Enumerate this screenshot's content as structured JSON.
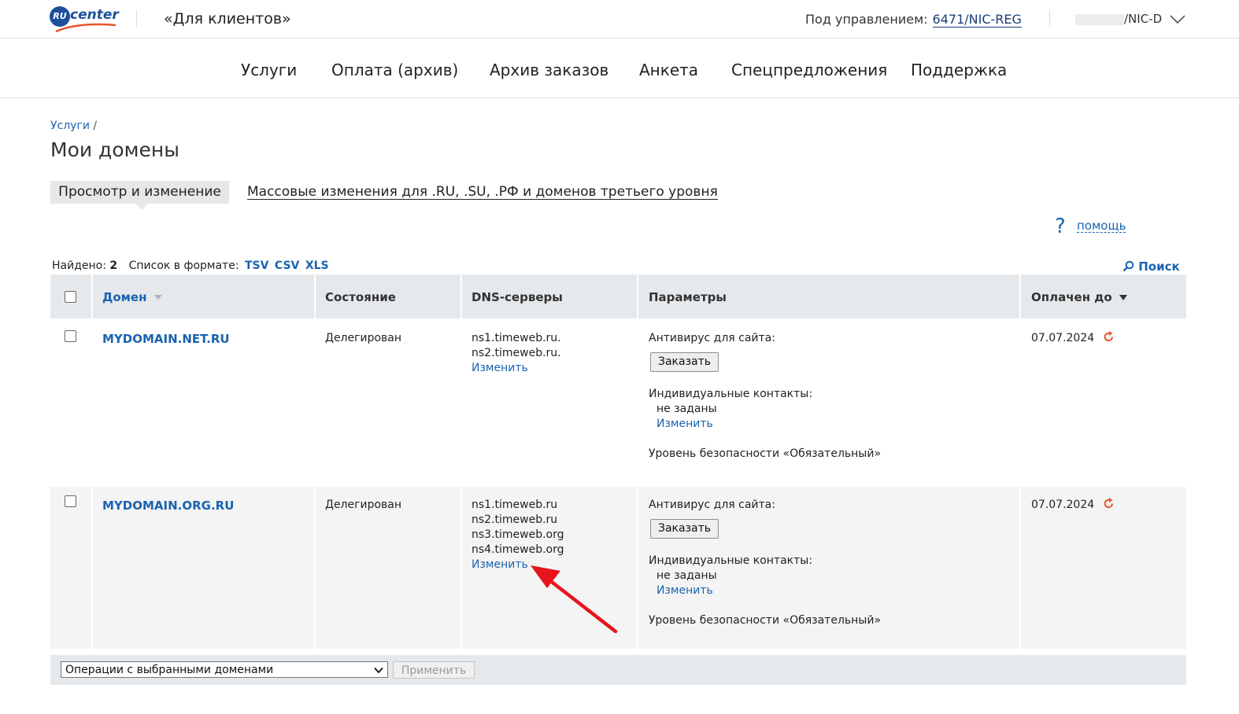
{
  "topbar": {
    "logo_ru": "RU",
    "logo_center": "center",
    "client_title": "«Для клиентов»",
    "managed_label": "Под управлением:",
    "managed_account": "6471/NIC-REG",
    "account_suffix": "/NIC-D"
  },
  "nav": {
    "items": [
      "Услуги",
      "Оплата (архив)",
      "Архив заказов",
      "Анкета",
      "Спецпредложения",
      "Поддержка"
    ]
  },
  "breadcrumb": {
    "link": "Услуги",
    "sep": "/"
  },
  "page_title": "Мои домены",
  "tabs": {
    "active": "Просмотр и изменение",
    "mass": "Массовые изменения для .RU, .SU, .РФ и доменов третьего уровня"
  },
  "help": {
    "icon": "?",
    "label": "помощь"
  },
  "found": {
    "label": "Найдено:",
    "count": "2",
    "format_label": "Список в формате:",
    "formats": [
      "TSV",
      "CSV",
      "XLS"
    ]
  },
  "search_label": "Поиск",
  "table": {
    "headers": {
      "domain": "Домен",
      "state": "Состояние",
      "dns": "DNS-серверы",
      "params": "Параметры",
      "paid": "Оплачен до"
    },
    "rows": [
      {
        "domain": "MYDOMAIN.NET.RU",
        "state": "Делегирован",
        "dns": [
          "ns1.timeweb.ru.",
          "ns2.timeweb.ru."
        ],
        "dns_edit": "Изменить",
        "antivirus_label": "Антивирус для сайта:",
        "order_button": "Заказать",
        "contacts_label": "Индивидуальные контакты:",
        "contacts_value": "не заданы",
        "contacts_edit": "Изменить",
        "security": "Уровень безопасности «Обязательный»",
        "paid_until": "07.07.2024"
      },
      {
        "domain": "MYDOMAIN.ORG.RU",
        "state": "Делегирован",
        "dns": [
          "ns1.timeweb.ru",
          "ns2.timeweb.ru",
          "ns3.timeweb.org",
          "ns4.timeweb.org"
        ],
        "dns_edit": "Изменить",
        "antivirus_label": "Антивирус для сайта:",
        "order_button": "Заказать",
        "contacts_label": "Индивидуальные контакты:",
        "contacts_value": "не заданы",
        "contacts_edit": "Изменить",
        "security": "Уровень безопасности «Обязательный»",
        "paid_until": "07.07.2024"
      }
    ]
  },
  "bottom": {
    "operations_select": "Операции с выбранными доменами",
    "apply_button": "Применить"
  },
  "colors": {
    "link": "#1a63b0",
    "brand": "#1d4f9c",
    "accent_orange": "#e8542a",
    "annotation_arrow": "#e8141c"
  }
}
